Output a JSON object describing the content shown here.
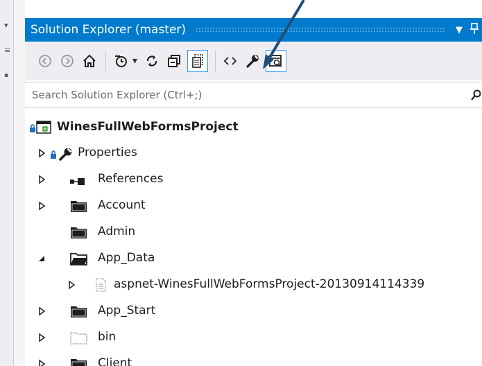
{
  "window": {
    "title": "Solution Explorer (master)",
    "dropdown_glyph": "▼",
    "pin_glyph": "ᵖ"
  },
  "toolbar": {
    "items": [
      {
        "name": "back-icon"
      },
      {
        "name": "forward-icon"
      },
      {
        "name": "home-icon"
      },
      {
        "name": "history-icon"
      },
      {
        "name": "sync-icon"
      },
      {
        "name": "collapse-all-icon"
      },
      {
        "name": "show-all-files-icon"
      },
      {
        "name": "view-code-icon"
      },
      {
        "name": "properties-wrench-icon"
      },
      {
        "name": "preview-selected-icon"
      }
    ],
    "dropdown_arrow": "▾"
  },
  "search": {
    "placeholder": "Search Solution Explorer (Ctrl+;)"
  },
  "tree": {
    "project": "WinesFullWebFormsProject",
    "items": [
      {
        "label": "Properties",
        "icon": "wrench-icon",
        "expander": "collapsed"
      },
      {
        "label": "References",
        "icon": "references-icon",
        "expander": "collapsed"
      },
      {
        "label": "Account",
        "icon": "folder-icon",
        "expander": "collapsed"
      },
      {
        "label": "Admin",
        "icon": "folder-icon",
        "expander": "none"
      },
      {
        "label": "App_Data",
        "icon": "folder-open-icon",
        "expander": "expanded"
      },
      {
        "label": "aspnet-WinesFullWebFormsProject-20130914114339",
        "icon": "file-icon",
        "expander": "collapsed"
      },
      {
        "label": "App_Start",
        "icon": "folder-icon",
        "expander": "collapsed"
      },
      {
        "label": "bin",
        "icon": "folder-dotted-icon",
        "expander": "collapsed"
      },
      {
        "label": "Client",
        "icon": "folder-icon",
        "expander": "collapsed"
      }
    ]
  },
  "colors": {
    "accent": "#007acc",
    "toolbar_bg": "#eeeef2",
    "arrow": "#1f4e79"
  }
}
